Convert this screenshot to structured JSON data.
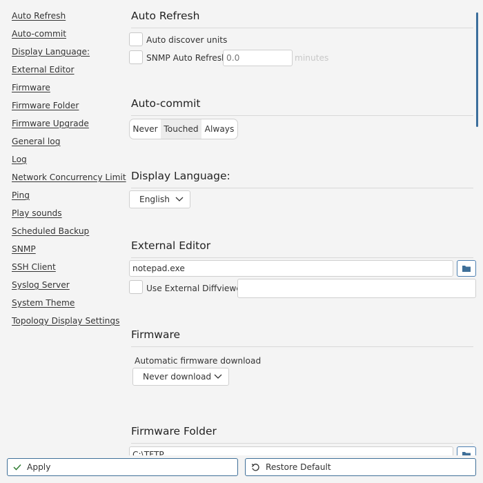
{
  "sidebar": {
    "items": [
      {
        "label": "Auto Refresh"
      },
      {
        "label": "Auto-commit"
      },
      {
        "label": "Display Language:"
      },
      {
        "label": "External Editor"
      },
      {
        "label": "Firmware"
      },
      {
        "label": "Firmware Folder"
      },
      {
        "label": "Firmware Upgrade"
      },
      {
        "label": "General log"
      },
      {
        "label": "Log"
      },
      {
        "label": "Network Concurrency Limit"
      },
      {
        "label": "Ping"
      },
      {
        "label": "Play sounds"
      },
      {
        "label": "Scheduled Backup"
      },
      {
        "label": "SNMP"
      },
      {
        "label": "SSH Client"
      },
      {
        "label": "Syslog Server"
      },
      {
        "label": "System Theme"
      },
      {
        "label": "Topology Display Settings"
      }
    ]
  },
  "auto_refresh": {
    "title": "Auto Refresh",
    "discover_label": "Auto discover units",
    "discover_checked": false,
    "snmp_label": "SNMP Auto Refresh",
    "snmp_checked": false,
    "snmp_placeholder": "0.0",
    "snmp_unit": "minutes"
  },
  "auto_commit": {
    "title": "Auto-commit",
    "options": [
      "Never",
      "Touched",
      "Always"
    ],
    "selected": "Touched"
  },
  "display_language": {
    "title": "Display Language:",
    "value": "English"
  },
  "external_editor": {
    "title": "External Editor",
    "path": "notepad.exe",
    "diff_label": "Use External Diffviewer",
    "diff_checked": false,
    "diff_path": ""
  },
  "firmware": {
    "title": "Firmware",
    "download_label": "Automatic firmware download",
    "download_value": "Never download"
  },
  "firmware_folder": {
    "title": "Firmware Folder",
    "path": "C:\\TFTP"
  },
  "footer": {
    "apply_label": "Apply",
    "restore_label": "Restore Default"
  },
  "colors": {
    "accent": "#3e6f98",
    "scrollbar": "#3b6e9c",
    "background": "#f4f4f4"
  }
}
